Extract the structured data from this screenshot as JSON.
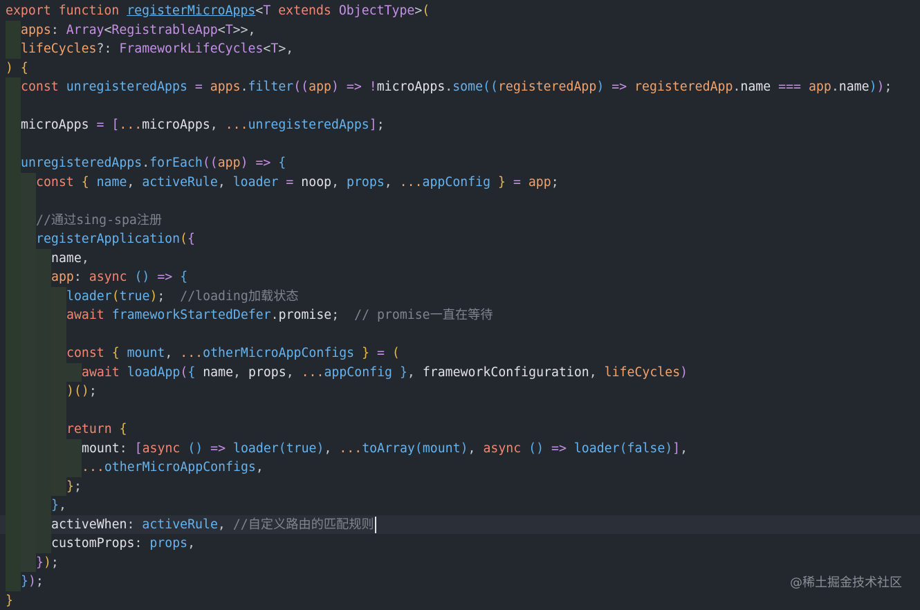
{
  "editor": {
    "language": "typescript",
    "cursor_line": 28,
    "lines": [
      {
        "indent": 0,
        "tokens": [
          [
            "kw",
            "export"
          ],
          [
            "pl",
            " "
          ],
          [
            "kw",
            "function"
          ],
          [
            "pl",
            " "
          ],
          [
            "fnu",
            "registerMicroApps"
          ],
          [
            "pu",
            "<"
          ],
          [
            "ty",
            "T"
          ],
          [
            "pl",
            " "
          ],
          [
            "kw",
            "extends"
          ],
          [
            "pl",
            " "
          ],
          [
            "ty",
            "ObjectType"
          ],
          [
            "pu",
            ">"
          ],
          [
            "br1",
            "("
          ]
        ]
      },
      {
        "indent": 1,
        "tokens": [
          [
            "pa",
            "apps"
          ],
          [
            "pu",
            ": "
          ],
          [
            "ty",
            "Array"
          ],
          [
            "pu",
            "<"
          ],
          [
            "ty",
            "RegistrableApp"
          ],
          [
            "pu",
            "<"
          ],
          [
            "ty",
            "T"
          ],
          [
            "pu",
            ">>,"
          ]
        ]
      },
      {
        "indent": 1,
        "tokens": [
          [
            "pa",
            "lifeCycles"
          ],
          [
            "pu",
            "?: "
          ],
          [
            "ty",
            "FrameworkLifeCycles"
          ],
          [
            "pu",
            "<"
          ],
          [
            "ty",
            "T"
          ],
          [
            "pu",
            ">,"
          ]
        ]
      },
      {
        "indent": 0,
        "tokens": [
          [
            "br1",
            ")"
          ],
          [
            "pl",
            " "
          ],
          [
            "br1",
            "{"
          ]
        ]
      },
      {
        "indent": 1,
        "tokens": [
          [
            "kw",
            "const"
          ],
          [
            "pl",
            " "
          ],
          [
            "fn",
            "unregisteredApps"
          ],
          [
            "pl",
            " "
          ],
          [
            "op",
            "="
          ],
          [
            "pl",
            " "
          ],
          [
            "pa",
            "apps"
          ],
          [
            "pu",
            "."
          ],
          [
            "fn",
            "filter"
          ],
          [
            "br2",
            "(("
          ],
          [
            "pa",
            "app"
          ],
          [
            "br2",
            ")"
          ],
          [
            "pl",
            " "
          ],
          [
            "op",
            "=>"
          ],
          [
            "pl",
            " "
          ],
          [
            "op",
            "!"
          ],
          [
            "pl",
            "microApps"
          ],
          [
            "pu",
            "."
          ],
          [
            "fn",
            "some"
          ],
          [
            "br3",
            "(("
          ],
          [
            "pa",
            "registeredApp"
          ],
          [
            "br3",
            ")"
          ],
          [
            "pl",
            " "
          ],
          [
            "op",
            "=>"
          ],
          [
            "pl",
            " "
          ],
          [
            "pa",
            "registeredApp"
          ],
          [
            "pu",
            "."
          ],
          [
            "pl",
            "name"
          ],
          [
            "pl",
            " "
          ],
          [
            "op",
            "==="
          ],
          [
            "pl",
            " "
          ],
          [
            "pa",
            "app"
          ],
          [
            "pu",
            "."
          ],
          [
            "pl",
            "name"
          ],
          [
            "br3",
            ")"
          ],
          [
            "br2",
            ")"
          ],
          [
            "pu",
            ";"
          ]
        ]
      },
      {
        "indent": 1,
        "tokens": []
      },
      {
        "indent": 1,
        "tokens": [
          [
            "pl",
            "microApps"
          ],
          [
            "pl",
            " "
          ],
          [
            "op",
            "="
          ],
          [
            "pl",
            " "
          ],
          [
            "br2",
            "["
          ],
          [
            "sp",
            "..."
          ],
          [
            "pl",
            "microApps"
          ],
          [
            "pu",
            ", "
          ],
          [
            "sp",
            "..."
          ],
          [
            "fn",
            "unregisteredApps"
          ],
          [
            "br2",
            "]"
          ],
          [
            "pu",
            ";"
          ]
        ]
      },
      {
        "indent": 1,
        "tokens": []
      },
      {
        "indent": 1,
        "tokens": [
          [
            "fn",
            "unregisteredApps"
          ],
          [
            "pu",
            "."
          ],
          [
            "fn",
            "forEach"
          ],
          [
            "br2",
            "(("
          ],
          [
            "pa",
            "app"
          ],
          [
            "br2",
            ")"
          ],
          [
            "pl",
            " "
          ],
          [
            "op",
            "=>"
          ],
          [
            "pl",
            " "
          ],
          [
            "br3",
            "{"
          ]
        ]
      },
      {
        "indent": 2,
        "tokens": [
          [
            "kw",
            "const"
          ],
          [
            "pl",
            " "
          ],
          [
            "br1",
            "{"
          ],
          [
            "pl",
            " "
          ],
          [
            "pr",
            "name"
          ],
          [
            "pu",
            ", "
          ],
          [
            "pr",
            "activeRule"
          ],
          [
            "pu",
            ", "
          ],
          [
            "pr",
            "loader"
          ],
          [
            "pl",
            " "
          ],
          [
            "op",
            "="
          ],
          [
            "pl",
            " "
          ],
          [
            "pl",
            "noop"
          ],
          [
            "pu",
            ", "
          ],
          [
            "pr",
            "props"
          ],
          [
            "pu",
            ", "
          ],
          [
            "sp",
            "..."
          ],
          [
            "pr",
            "appConfig"
          ],
          [
            "pl",
            " "
          ],
          [
            "br1",
            "}"
          ],
          [
            "pl",
            " "
          ],
          [
            "op",
            "="
          ],
          [
            "pl",
            " "
          ],
          [
            "pa",
            "app"
          ],
          [
            "pu",
            ";"
          ]
        ]
      },
      {
        "indent": 2,
        "tokens": []
      },
      {
        "indent": 2,
        "tokens": [
          [
            "cm",
            "//通过sing-spa注册"
          ]
        ]
      },
      {
        "indent": 2,
        "tokens": [
          [
            "fn",
            "registerApplication"
          ],
          [
            "br1",
            "("
          ],
          [
            "br2",
            "{"
          ]
        ]
      },
      {
        "indent": 3,
        "tokens": [
          [
            "pl",
            "name"
          ],
          [
            "pu",
            ","
          ]
        ]
      },
      {
        "indent": 3,
        "tokens": [
          [
            "pa",
            "app"
          ],
          [
            "pu",
            ": "
          ],
          [
            "kw",
            "async"
          ],
          [
            "pl",
            " "
          ],
          [
            "br3",
            "()"
          ],
          [
            "pl",
            " "
          ],
          [
            "op",
            "=>"
          ],
          [
            "pl",
            " "
          ],
          [
            "br3",
            "{"
          ]
        ]
      },
      {
        "indent": 4,
        "tokens": [
          [
            "fn",
            "loader"
          ],
          [
            "br1",
            "("
          ],
          [
            "lit",
            "true"
          ],
          [
            "br1",
            ")"
          ],
          [
            "pu",
            ";"
          ],
          [
            "pl",
            "  "
          ],
          [
            "cm",
            "//loading加载状态"
          ]
        ]
      },
      {
        "indent": 4,
        "tokens": [
          [
            "kw",
            "await"
          ],
          [
            "pl",
            " "
          ],
          [
            "fn",
            "frameworkStartedDefer"
          ],
          [
            "pu",
            "."
          ],
          [
            "pl",
            "promise"
          ],
          [
            "pu",
            ";"
          ],
          [
            "pl",
            "  "
          ],
          [
            "cm",
            "// promise一直在等待"
          ]
        ]
      },
      {
        "indent": 4,
        "tokens": []
      },
      {
        "indent": 4,
        "tokens": [
          [
            "kw",
            "const"
          ],
          [
            "pl",
            " "
          ],
          [
            "br1",
            "{"
          ],
          [
            "pl",
            " "
          ],
          [
            "pr",
            "mount"
          ],
          [
            "pu",
            ", "
          ],
          [
            "sp",
            "..."
          ],
          [
            "pr",
            "otherMicroAppConfigs"
          ],
          [
            "pl",
            " "
          ],
          [
            "br1",
            "}"
          ],
          [
            "pl",
            " "
          ],
          [
            "op",
            "="
          ],
          [
            "pl",
            " "
          ],
          [
            "br1",
            "("
          ]
        ]
      },
      {
        "indent": 5,
        "tokens": [
          [
            "kw",
            "await"
          ],
          [
            "pl",
            " "
          ],
          [
            "fn",
            "loadApp"
          ],
          [
            "br2",
            "("
          ],
          [
            "br3",
            "{"
          ],
          [
            "pl",
            " "
          ],
          [
            "pl",
            "name"
          ],
          [
            "pu",
            ", "
          ],
          [
            "pl",
            "props"
          ],
          [
            "pu",
            ", "
          ],
          [
            "sp",
            "..."
          ],
          [
            "fn",
            "appConfig"
          ],
          [
            "pl",
            " "
          ],
          [
            "br3",
            "}"
          ],
          [
            "pu",
            ", "
          ],
          [
            "pl",
            "frameworkConfiguration"
          ],
          [
            "pu",
            ", "
          ],
          [
            "pa",
            "lifeCycles"
          ],
          [
            "br2",
            ")"
          ]
        ]
      },
      {
        "indent": 4,
        "tokens": [
          [
            "br1",
            ")"
          ],
          [
            "br1",
            "()"
          ],
          [
            "pu",
            ";"
          ]
        ]
      },
      {
        "indent": 4,
        "tokens": []
      },
      {
        "indent": 4,
        "tokens": [
          [
            "kw",
            "return"
          ],
          [
            "pl",
            " "
          ],
          [
            "br1",
            "{"
          ]
        ]
      },
      {
        "indent": 5,
        "tokens": [
          [
            "pl",
            "mount"
          ],
          [
            "pu",
            ": "
          ],
          [
            "br2",
            "["
          ],
          [
            "kw",
            "async"
          ],
          [
            "pl",
            " "
          ],
          [
            "br3",
            "()"
          ],
          [
            "pl",
            " "
          ],
          [
            "op",
            "=>"
          ],
          [
            "pl",
            " "
          ],
          [
            "fn",
            "loader"
          ],
          [
            "br3",
            "("
          ],
          [
            "lit",
            "true"
          ],
          [
            "br3",
            ")"
          ],
          [
            "pu",
            ", "
          ],
          [
            "sp",
            "..."
          ],
          [
            "fn",
            "toArray"
          ],
          [
            "br3",
            "("
          ],
          [
            "pr",
            "mount"
          ],
          [
            "br3",
            ")"
          ],
          [
            "pu",
            ", "
          ],
          [
            "kw",
            "async"
          ],
          [
            "pl",
            " "
          ],
          [
            "br3",
            "()"
          ],
          [
            "pl",
            " "
          ],
          [
            "op",
            "=>"
          ],
          [
            "pl",
            " "
          ],
          [
            "fn",
            "loader"
          ],
          [
            "br3",
            "("
          ],
          [
            "lit",
            "false"
          ],
          [
            "br3",
            ")"
          ],
          [
            "br2",
            "]"
          ],
          [
            "pu",
            ","
          ]
        ]
      },
      {
        "indent": 5,
        "tokens": [
          [
            "sp",
            "..."
          ],
          [
            "fn",
            "otherMicroAppConfigs"
          ],
          [
            "pu",
            ","
          ]
        ]
      },
      {
        "indent": 4,
        "tokens": [
          [
            "br1",
            "}"
          ],
          [
            "pu",
            ";"
          ]
        ]
      },
      {
        "indent": 3,
        "tokens": [
          [
            "br3",
            "}"
          ],
          [
            "pu",
            ","
          ]
        ]
      },
      {
        "indent": 3,
        "tokens": [
          [
            "pl",
            "activeWhen"
          ],
          [
            "pu",
            ": "
          ],
          [
            "pr",
            "activeRule"
          ],
          [
            "pu",
            ", "
          ],
          [
            "cm",
            "//自定义路由的匹配规则"
          ]
        ]
      },
      {
        "indent": 3,
        "tokens": [
          [
            "pl",
            "customProps"
          ],
          [
            "pu",
            ": "
          ],
          [
            "pr",
            "props"
          ],
          [
            "pu",
            ","
          ]
        ]
      },
      {
        "indent": 2,
        "tokens": [
          [
            "br2",
            "}"
          ],
          [
            "br1",
            ")"
          ],
          [
            "pu",
            ";"
          ]
        ]
      },
      {
        "indent": 1,
        "tokens": [
          [
            "br3",
            "}"
          ],
          [
            "br2",
            ")"
          ],
          [
            "pu",
            ";"
          ]
        ]
      },
      {
        "indent": 0,
        "tokens": [
          [
            "br1",
            "}"
          ]
        ]
      }
    ]
  },
  "watermark": {
    "text": "@稀土掘金技术社区"
  },
  "colors": {
    "background": "#23272e",
    "current_line": "#2b2f37",
    "guide_even": "#2c3a2e",
    "guide_odd": "#2f3a33"
  }
}
